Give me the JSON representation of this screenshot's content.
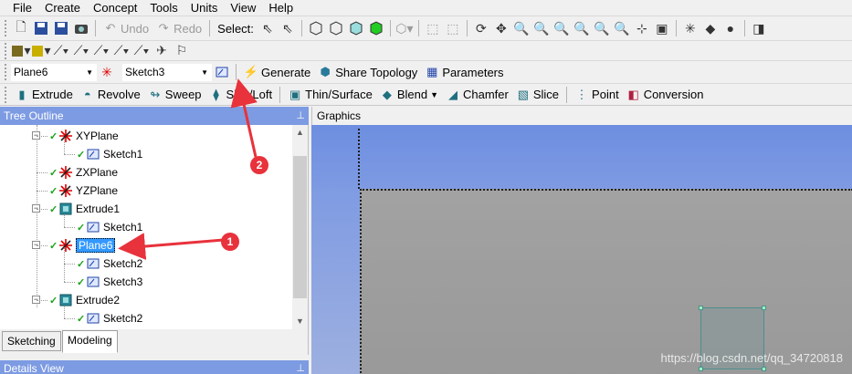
{
  "menu": [
    "File",
    "Create",
    "Concept",
    "Tools",
    "Units",
    "View",
    "Help"
  ],
  "toolbar1": {
    "undo": "Undo",
    "redo": "Redo",
    "select_label": "Select:"
  },
  "toolbar3": {
    "plane_combo": "Plane6",
    "sketch_combo": "Sketch3",
    "generate": "Generate",
    "share_topology": "Share Topology",
    "parameters": "Parameters"
  },
  "toolbar4": [
    "Extrude",
    "Revolve",
    "Sweep",
    "Skin/Loft",
    "Thin/Surface",
    "Blend",
    "Chamfer",
    "Slice",
    "Point",
    "Conversion"
  ],
  "tree": {
    "header": "Tree Outline",
    "items": [
      {
        "label": "XYPlane",
        "type": "plane"
      },
      {
        "label": "Sketch1",
        "type": "sketch"
      },
      {
        "label": "ZXPlane",
        "type": "plane"
      },
      {
        "label": "YZPlane",
        "type": "plane"
      },
      {
        "label": "Extrude1",
        "type": "extrude"
      },
      {
        "label": "Sketch1",
        "type": "sketch"
      },
      {
        "label": "Plane6",
        "type": "plane",
        "selected": true
      },
      {
        "label": "Sketch2",
        "type": "sketch"
      },
      {
        "label": "Sketch3",
        "type": "sketch"
      },
      {
        "label": "Extrude2",
        "type": "extrude"
      },
      {
        "label": "Sketch2",
        "type": "sketch"
      }
    ]
  },
  "tabs": {
    "sketching": "Sketching",
    "modeling": "Modeling",
    "active": "Modeling"
  },
  "details": {
    "header": "Details View"
  },
  "graphics": {
    "header": "Graphics",
    "watermark": "https://blog.csdn.net/qq_34720818"
  },
  "annotations": {
    "badge1": "1",
    "badge2": "2",
    "color": "#e8323c"
  },
  "colors": {
    "panel_header": "#7d9be2",
    "selection": "#3399ff",
    "check": "#1aa31a"
  }
}
